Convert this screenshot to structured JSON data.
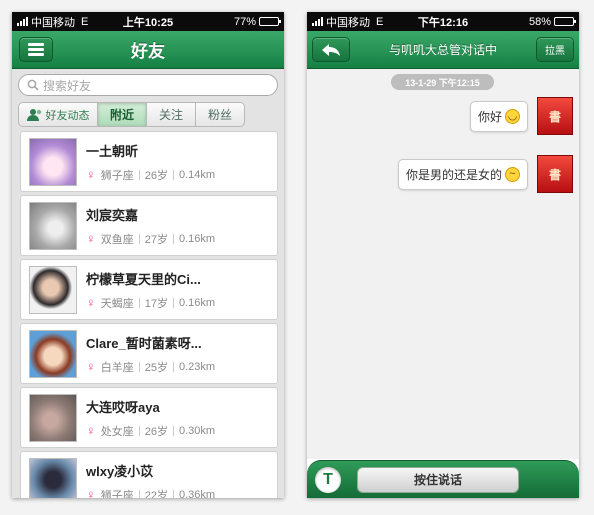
{
  "left": {
    "status": {
      "carrier": "中国移动",
      "network": "E",
      "time": "上午10:25",
      "battery_percent": "77%",
      "battery_level": 0.77
    },
    "navbar": {
      "title": "好友"
    },
    "search": {
      "placeholder": "搜索好友"
    },
    "tabs": [
      {
        "label": "好友动态",
        "icon": "user-icon"
      },
      {
        "label": "附近",
        "selected": true
      },
      {
        "label": "关注"
      },
      {
        "label": "粉丝"
      }
    ],
    "friends": [
      {
        "name": "一土朝昕",
        "gender_icon": "♀",
        "zodiac": "狮子座",
        "age": "26岁",
        "distance": "0.14km"
      },
      {
        "name": "刘宸奕嘉",
        "gender_icon": "♀",
        "zodiac": "双鱼座",
        "age": "27岁",
        "distance": "0.16km"
      },
      {
        "name": "柠檬草夏天里的Ci...",
        "gender_icon": "♀",
        "zodiac": "天蝎座",
        "age": "17岁",
        "distance": "0.16km"
      },
      {
        "name": "Clare_暂时菌素呀...",
        "gender_icon": "♀",
        "zodiac": "白羊座",
        "age": "25岁",
        "distance": "0.23km"
      },
      {
        "name": "大连哎呀aya",
        "gender_icon": "♀",
        "zodiac": "处女座",
        "age": "26岁",
        "distance": "0.30km"
      },
      {
        "name": "wlxy凌小苡",
        "gender_icon": "♀",
        "zodiac": "狮子座",
        "age": "22岁",
        "distance": "0.36km"
      }
    ]
  },
  "right": {
    "status": {
      "carrier": "中国移动",
      "network": "E",
      "time": "下午12:16",
      "battery_percent": "58%",
      "battery_level": 0.58
    },
    "navbar": {
      "title": "与叽叽大总管对话中",
      "block_label": "拉黑"
    },
    "chat": {
      "timestamp": "13-1-29 下午12:15",
      "messages": [
        {
          "text": "你好",
          "emoji": "smile-icon",
          "avatar_text": "書"
        },
        {
          "text": "你是男的还是女的",
          "emoji": "thinking-icon",
          "avatar_text": "書"
        }
      ]
    },
    "input": {
      "t_label": "T",
      "talk_label": "按住说话"
    }
  },
  "colors": {
    "nav_green": "#168044",
    "female": "#e84a8c",
    "background": "#f3f3f3"
  }
}
